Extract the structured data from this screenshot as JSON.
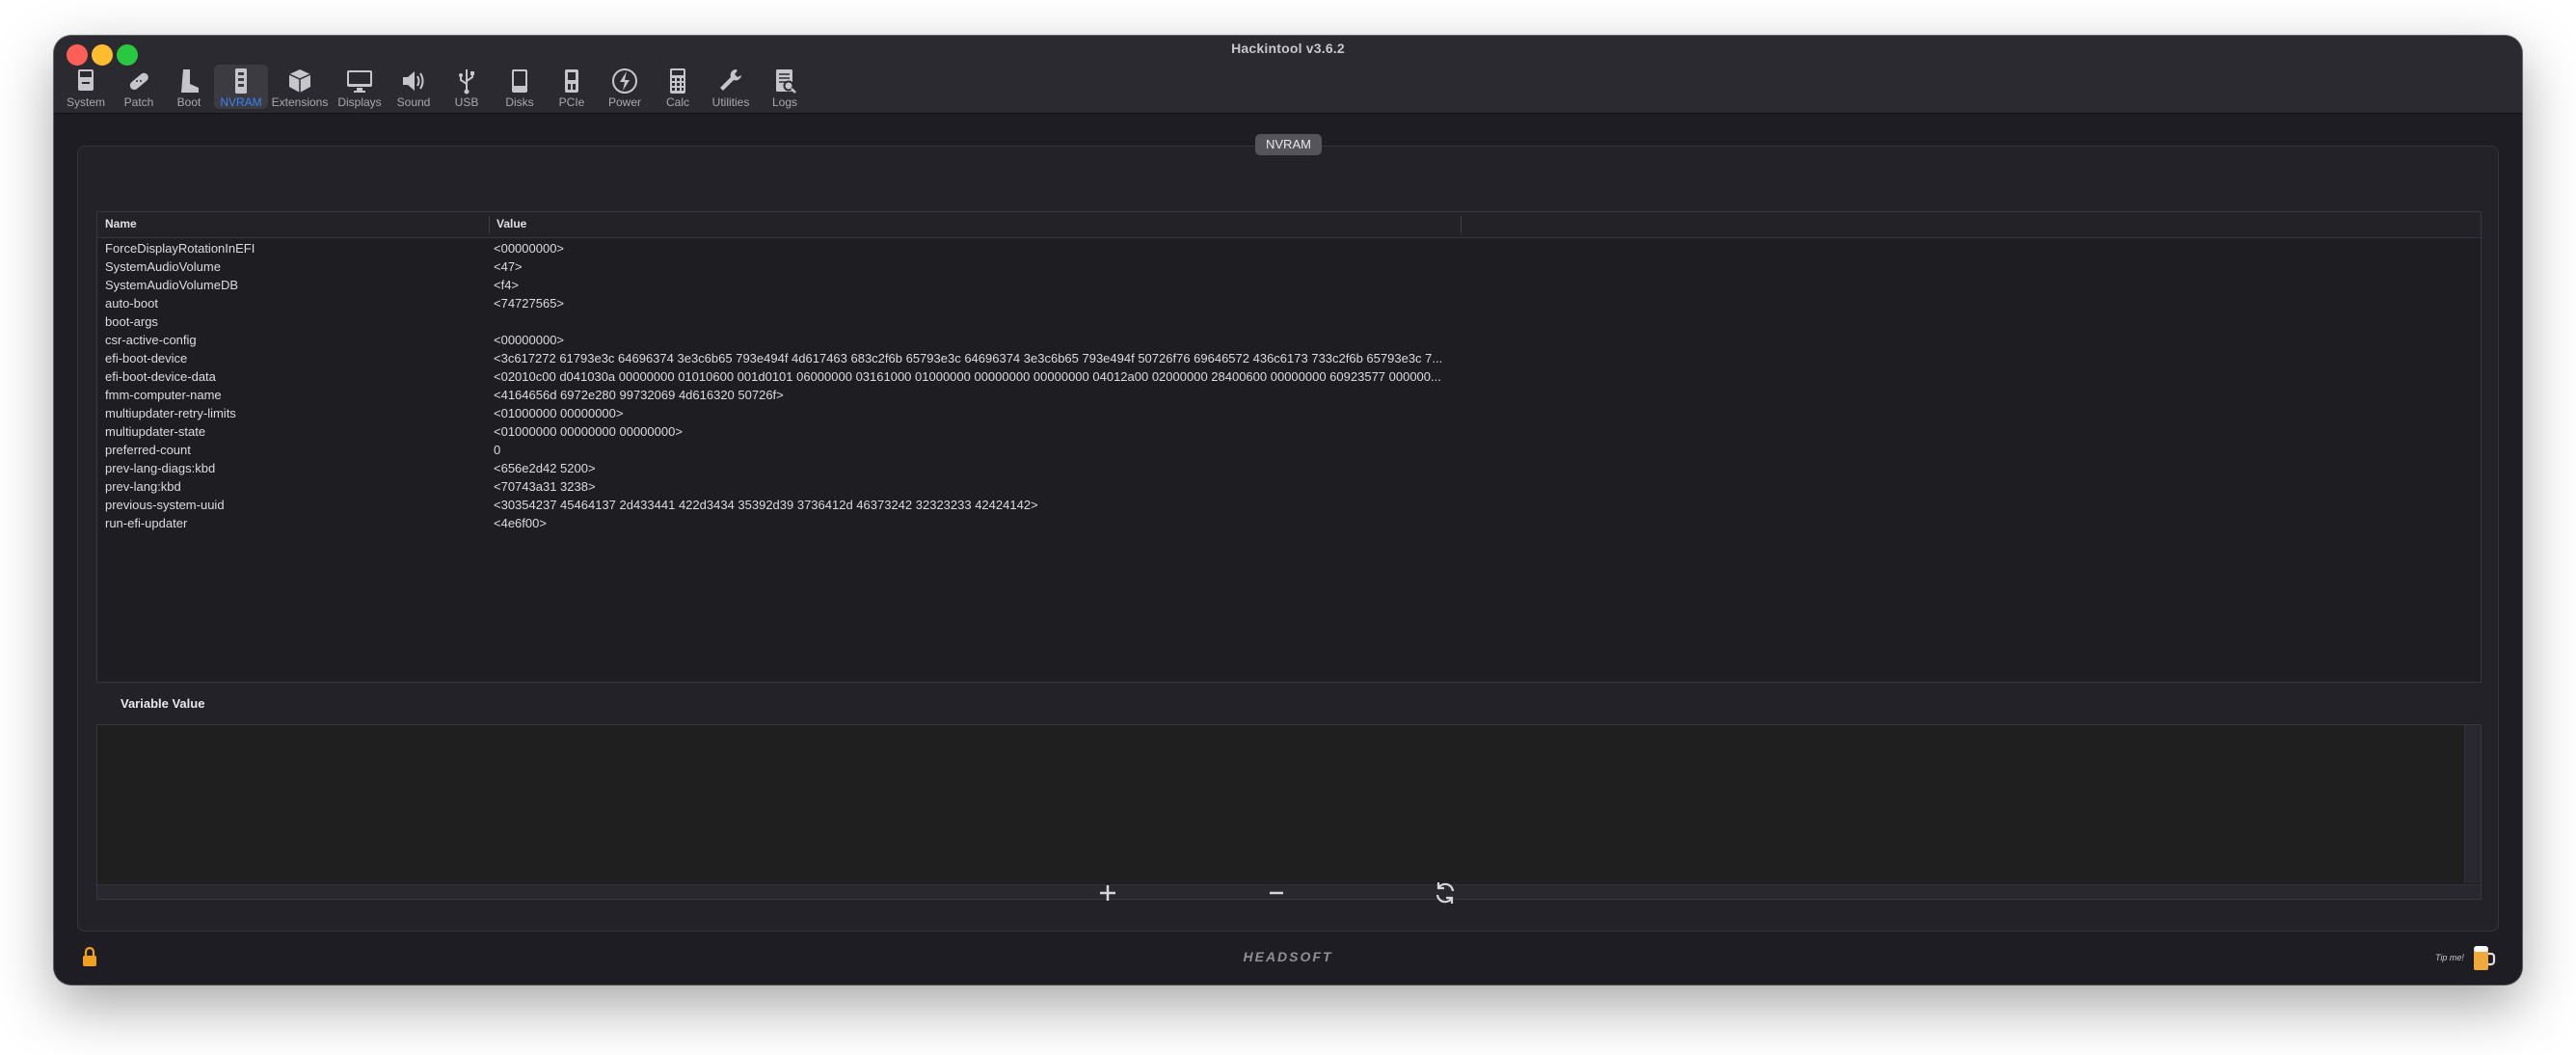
{
  "window": {
    "title": "Hackintool v3.6.2"
  },
  "toolbar": {
    "items": [
      {
        "label": "System",
        "icon": "system-icon"
      },
      {
        "label": "Patch",
        "icon": "patch-icon"
      },
      {
        "label": "Boot",
        "icon": "boot-icon"
      },
      {
        "label": "NVRAM",
        "icon": "nvram-icon",
        "active": true
      },
      {
        "label": "Extensions",
        "icon": "extensions-icon"
      },
      {
        "label": "Displays",
        "icon": "displays-icon"
      },
      {
        "label": "Sound",
        "icon": "sound-icon"
      },
      {
        "label": "USB",
        "icon": "usb-icon"
      },
      {
        "label": "Disks",
        "icon": "disks-icon"
      },
      {
        "label": "PCIe",
        "icon": "pcie-icon"
      },
      {
        "label": "Power",
        "icon": "power-icon"
      },
      {
        "label": "Calc",
        "icon": "calc-icon"
      },
      {
        "label": "Utilities",
        "icon": "utilities-icon"
      },
      {
        "label": "Logs",
        "icon": "logs-icon"
      }
    ]
  },
  "nvram": {
    "group_title": "NVRAM",
    "table": {
      "columns": [
        "Name",
        "Value"
      ],
      "rows": [
        {
          "name": "ForceDisplayRotationInEFI",
          "value": "<00000000>"
        },
        {
          "name": "SystemAudioVolume",
          "value": "<47>"
        },
        {
          "name": "SystemAudioVolumeDB",
          "value": "<f4>"
        },
        {
          "name": "auto-boot",
          "value": "<74727565>"
        },
        {
          "name": "boot-args",
          "value": ""
        },
        {
          "name": "csr-active-config",
          "value": "<00000000>"
        },
        {
          "name": "efi-boot-device",
          "value": "<3c617272 61793e3c 64696374 3e3c6b65 793e494f 4d617463 683c2f6b 65793e3c 64696374 3e3c6b65 793e494f 50726f76 69646572 436c6173 733c2f6b 65793e3c 7..."
        },
        {
          "name": "efi-boot-device-data",
          "value": "<02010c00 d041030a 00000000 01010600 001d0101 06000000 03161000 01000000 00000000 00000000 04012a00 02000000 28400600 00000000 60923577 000000..."
        },
        {
          "name": "fmm-computer-name",
          "value": "<4164656d 6972e280 99732069 4d616320 50726f>"
        },
        {
          "name": "multiupdater-retry-limits",
          "value": "<01000000 00000000>"
        },
        {
          "name": "multiupdater-state",
          "value": "<01000000 00000000 00000000>"
        },
        {
          "name": "preferred-count",
          "value": "0"
        },
        {
          "name": "prev-lang-diags:kbd",
          "value": "<656e2d42 5200>"
        },
        {
          "name": "prev-lang:kbd",
          "value": "<70743a31 3238>"
        },
        {
          "name": "previous-system-uuid",
          "value": "<30354237 45464137 2d433441 422d3434 35392d39 3736412d 46373242 32323233 42424142>"
        },
        {
          "name": "run-efi-updater",
          "value": "<4e6f00>"
        }
      ]
    },
    "variable_value_label": "Variable Value",
    "variable_value": ""
  },
  "actions": {
    "add_icon": "plus-icon",
    "remove_icon": "minus-icon",
    "refresh_icon": "refresh-icon"
  },
  "footer": {
    "lock_icon": "lock-icon",
    "logo_text": "HEADSOFT",
    "tip_label": "Tip me!",
    "beer_icon": "beer-icon"
  }
}
